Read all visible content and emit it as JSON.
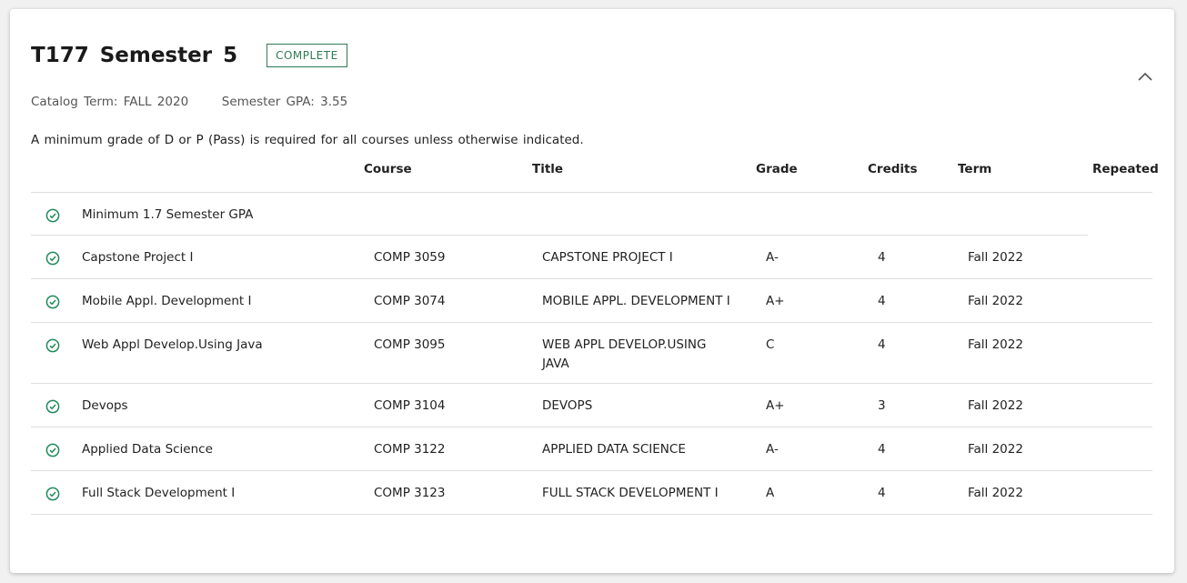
{
  "header": {
    "title": "T177 Semester 5",
    "status": "COMPLETE",
    "catalog_term_label": "Catalog Term:",
    "catalog_term_value": "FALL 2020",
    "gpa_label": "Semester GPA:",
    "gpa_value": "3.55",
    "notice": "A minimum grade of D or P (Pass) is required for all courses unless otherwise indicated."
  },
  "table": {
    "columns": {
      "course": "Course",
      "title": "Title",
      "grade": "Grade",
      "credits": "Credits",
      "term": "Term",
      "repeated": "Repeated"
    },
    "gpa_requirement": "Minimum 1.7 Semester GPA",
    "rows": [
      {
        "name": "Capstone Project I",
        "course": "COMP 3059",
        "title": "CAPSTONE PROJECT I",
        "grade": "A-",
        "credits": "4",
        "term": "Fall 2022"
      },
      {
        "name": "Mobile Appl. Development I",
        "course": "COMP 3074",
        "title": "MOBILE APPL. DEVELOPMENT I",
        "grade": "A+",
        "credits": "4",
        "term": "Fall 2022"
      },
      {
        "name": "Web Appl Develop.Using Java",
        "course": "COMP 3095",
        "title": "WEB APPL DEVELOP.USING JAVA",
        "grade": "C",
        "credits": "4",
        "term": "Fall 2022"
      },
      {
        "name": "Devops",
        "course": "COMP 3104",
        "title": "DEVOPS",
        "grade": "A+",
        "credits": "3",
        "term": "Fall 2022"
      },
      {
        "name": "Applied Data Science",
        "course": "COMP 3122",
        "title": "APPLIED DATA SCIENCE",
        "grade": "A-",
        "credits": "4",
        "term": "Fall 2022"
      },
      {
        "name": "Full Stack Development I",
        "course": "COMP 3123",
        "title": "FULL STACK DEVELOPMENT I",
        "grade": "A",
        "credits": "4",
        "term": "Fall 2022"
      }
    ]
  },
  "icons": {
    "status_check": "check-circle-icon",
    "collapse": "chevron-up-icon"
  },
  "colors": {
    "accent_green": "#2f7a55",
    "check_green": "#1f8a5a"
  }
}
